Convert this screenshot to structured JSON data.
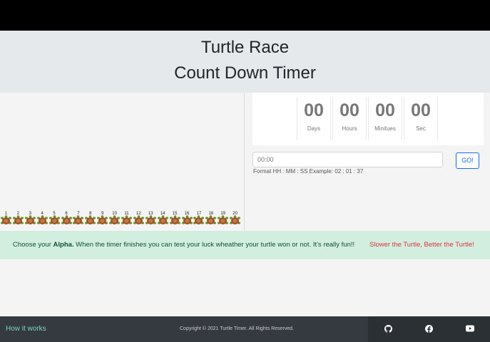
{
  "header": {
    "title_line1": "Turtle Race",
    "title_line2": "Count Down Timer"
  },
  "race": {
    "turtle_numbers": [
      "1",
      "2",
      "3",
      "4",
      "5",
      "6",
      "7",
      "8",
      "9",
      "10",
      "11",
      "12",
      "13",
      "14",
      "15",
      "16",
      "17",
      "18",
      "19",
      "20"
    ]
  },
  "timer": {
    "units": [
      {
        "value": "00",
        "label": "Days"
      },
      {
        "value": "00",
        "label": "Hours"
      },
      {
        "value": "00",
        "label": "Minitues"
      },
      {
        "value": "00",
        "label": "Sec"
      }
    ]
  },
  "form": {
    "input_placeholder": "00:00",
    "go_label": "GO!",
    "hint": "Format HH : MM : SS Example: 02 : 01 : 37"
  },
  "banner": {
    "text_before": "Choose your ",
    "bold_word": "Alpha.",
    "text_after": " When the timer finishes you can test your luck wheather your turtle won or not. It's really fun!!",
    "highlight": "Slower the Turtle, Better the Turtle!"
  },
  "footer": {
    "how_label": "How it works",
    "copyright": "Copyright © 2021 Turtle Timer. All Rights Reserved.",
    "icons": [
      "github-icon",
      "facebook-icon",
      "youtube-icon"
    ]
  },
  "colors": {
    "accent": "#0d6efd",
    "footer_bg": "#343a40",
    "banner_bg": "#d2eede",
    "highlight": "#dc3545"
  }
}
